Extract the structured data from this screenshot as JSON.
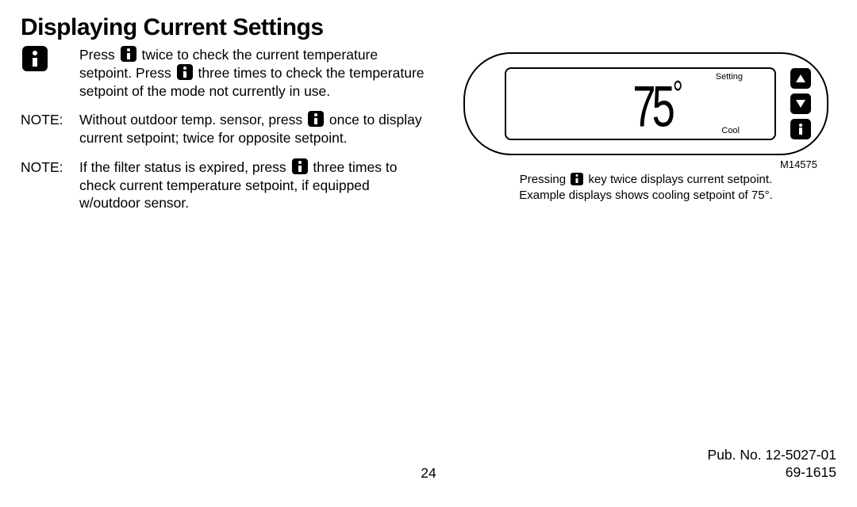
{
  "title": "Displaying Current Settings",
  "para1": {
    "pre": "Press ",
    "mid": " twice to check the current temperature setpoint.  Press ",
    "post": " three times to check the temperature setpoint of the mode not currently in use."
  },
  "note1": {
    "label": "NOTE:",
    "pre": "Without outdoor temp. sensor, press ",
    "post": " once to display current setpoint; twice for opposite setpoint."
  },
  "note2": {
    "label": "NOTE:",
    "pre": "If the filter status is expired, press ",
    "post": " three times to check current temperature setpoint, if equipped w/outdoor sensor."
  },
  "device": {
    "label_top": "Setting",
    "label_bot": "Cool",
    "temp": "75",
    "deg": "°"
  },
  "figure_no": "M14575",
  "caption": {
    "line1_pre": "Pressing ",
    "line1_post": " key twice displays current setpoint.",
    "line2": "Example displays shows cooling setpoint of 75°."
  },
  "footer": {
    "page": "24",
    "pub": "Pub. No. 12-5027-01",
    "doc": "69-1615"
  }
}
